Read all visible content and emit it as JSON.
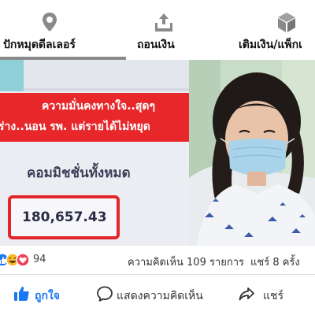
{
  "tabs": [
    {
      "label": "ปักหมุดดีลเลอร์",
      "icon": "location-pin-icon",
      "active": true
    },
    {
      "label": "ถอนเงิน",
      "icon": "withdraw-tray-icon",
      "active": false
    },
    {
      "label": "เติมเงิน/แพ็กเ",
      "icon": "package-box-icon",
      "active": false
    }
  ],
  "post_image": {
    "banner_line1": "ความมั่นคงทางใจ..สุดๆ",
    "banner_line2": "ร่าง..นอน รพ. แต่รายได้ไม่หยุด",
    "commission_label": "คอมมิชชั่นทั้งหมด",
    "commission_amount": "180,657.43",
    "photo": "woman-in-hospital-bed-with-face-mask"
  },
  "stats": {
    "reaction_icons": [
      "like-reaction-icon",
      "haha-reaction-icon",
      "love-reaction-icon"
    ],
    "reaction_count": "94",
    "comments": "ความคิดเห็น 109 รายการ",
    "shares": "แชร์ 8 ครั้ง"
  },
  "actions": {
    "like": "ถูกใจ",
    "comment": "แสดงความคิดเห็น",
    "share": "แชร์"
  },
  "colors": {
    "banner_red": "#e8272b",
    "like_blue": "#1877f2",
    "active_tab_underline": "#8a8a8a"
  }
}
